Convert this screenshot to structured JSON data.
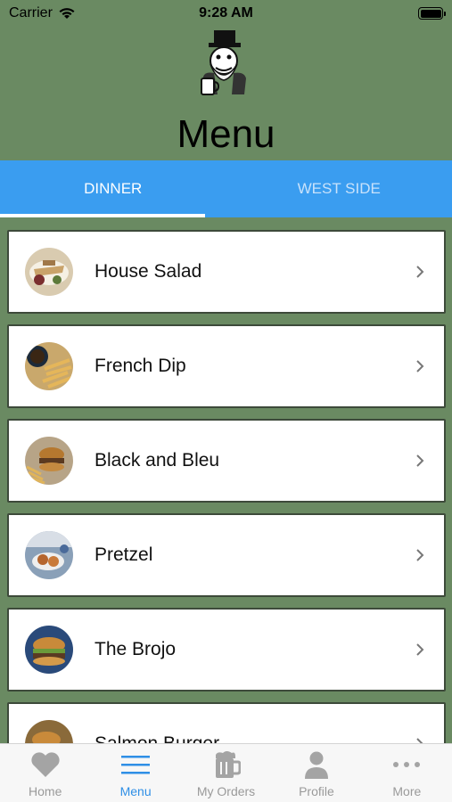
{
  "status_bar": {
    "carrier": "Carrier",
    "time": "9:28 AM"
  },
  "header": {
    "title": "Menu"
  },
  "tabs": [
    {
      "label": "DINNER",
      "selected": true
    },
    {
      "label": "WEST SIDE",
      "selected": false
    }
  ],
  "menu_items": [
    {
      "label": "House Salad"
    },
    {
      "label": "French Dip"
    },
    {
      "label": "Black and Bleu"
    },
    {
      "label": "Pretzel"
    },
    {
      "label": "The Brojo"
    },
    {
      "label": "Salmon Burger"
    }
  ],
  "bottom_nav": [
    {
      "label": "Home",
      "icon": "heart-icon"
    },
    {
      "label": "Menu",
      "icon": "hamburger-menu-icon",
      "active": true
    },
    {
      "label": "My Orders",
      "icon": "beer-mug-icon"
    },
    {
      "label": "Profile",
      "icon": "person-icon"
    },
    {
      "label": "More",
      "icon": "more-dots-icon"
    }
  ],
  "colors": {
    "background": "#6a8a62",
    "tab_bar": "#3a9df0",
    "active_nav": "#2f8fe6",
    "inactive_nav": "#9a9a9a"
  }
}
